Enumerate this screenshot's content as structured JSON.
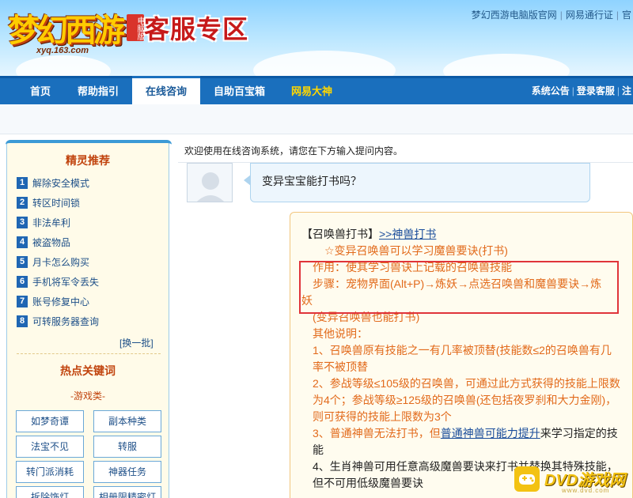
{
  "header": {
    "logo_text": "梦幻西游",
    "logo_edition": "电脑版",
    "logo_url": "xyq.163.com",
    "zone_title": "客服专区",
    "top_links": [
      "梦幻西游电脑版官网",
      "网易通行证",
      "官"
    ]
  },
  "nav": {
    "items": [
      "首页",
      "帮助指引",
      "在线咨询",
      "自助百宝箱",
      "网易大神"
    ],
    "active_index": 2,
    "right_links": [
      "系统公告",
      "登录客服",
      "注"
    ]
  },
  "sidebar": {
    "recommend_title": "精灵推荐",
    "recommend_items": [
      {
        "num": "1",
        "label": "解除安全模式"
      },
      {
        "num": "2",
        "label": "转区时间锁"
      },
      {
        "num": "3",
        "label": "非法牟利"
      },
      {
        "num": "4",
        "label": "被盗物品"
      },
      {
        "num": "5",
        "label": "月卡怎么购买"
      },
      {
        "num": "6",
        "label": "手机将军令丢失"
      },
      {
        "num": "7",
        "label": "账号修复中心"
      },
      {
        "num": "8",
        "label": "可转服务器查询"
      }
    ],
    "swap_label": "[换一批]",
    "hot_title": "热点关键词",
    "category": "-游戏类-",
    "keywords": [
      "如梦奇谭",
      "副本种类",
      "法宝不见",
      "转服",
      "转门派消耗",
      "神器任务",
      "拆除饰灯",
      "相册限精密灯"
    ]
  },
  "chat": {
    "welcome": "欢迎使用在线咨询系统，请您在下方输入提问内容。",
    "user_question": "变异宝宝能打书吗？",
    "answer": {
      "head_bracket": "【召唤兽打书】",
      "head_link": ">>神兽打书",
      "line1": "☆变异召唤兽可以学习魔兽要诀(打书)",
      "line2": "作用：使其学习兽诀上记载的召唤兽技能",
      "line3a": "步骤：宠物界面(Alt+P)→炼妖→点选召唤兽和魔兽要诀→炼",
      "line3b": "妖",
      "line4": "(变异召唤兽也能打书)",
      "line5": "其他说明：",
      "line6": "1、召唤兽原有技能之一有几率被顶替(技能数≤2的召唤兽有几率不被顶替",
      "line7": "2、参战等级≤105级的召唤兽，可通过此方式获得的技能上限数为4个；参战等级≥125级的召唤兽(还包括夜罗刹和大力金刚)，则可获得的技能上限数为3个",
      "line8_pre": "3、普通神兽无法打书，但",
      "line8_link": "普通神兽可能力提升",
      "line8_post": "来学习指定的技能",
      "line9": "4、生肖神兽可用任意高级魔兽要诀来打书并替换其特殊技能，但不可用低级魔兽要诀"
    }
  },
  "watermark": {
    "text": "DVD游戏网",
    "sub": "www.dvd.com"
  },
  "colors": {
    "nav_blue": "#1a6fbd",
    "answer_orange": "#e26a1b",
    "highlight_red": "#e0343a",
    "link_blue": "#1a4d9b"
  }
}
